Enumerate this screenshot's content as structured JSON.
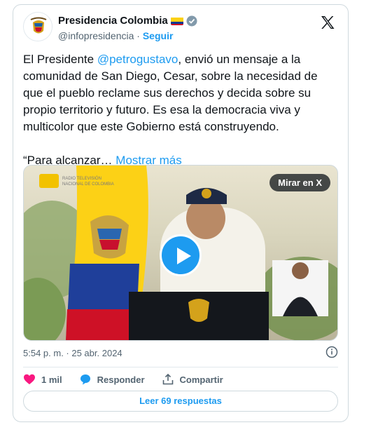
{
  "account": {
    "name": "Presidencia Colombia",
    "handle": "@infopresidencia",
    "separator": "·",
    "follow_label": "Seguir"
  },
  "tweet": {
    "text_part1": "El Presidente ",
    "mention": "@petrogustavo",
    "text_part2": ", envió un mensaje a la comunidad de San Diego, Cesar, sobre la necesidad de que el pueblo reclame sus derechos y decida sobre su propio territorio y futuro. Es esa la democracia viva y multicolor que este Gobierno está construyendo.\n\n“Para alcanzar… ",
    "show_more": "Mostrar más",
    "timestamp": "5:54 p. m. · 25 abr. 2024"
  },
  "media": {
    "watch_on_x_label": "Mirar en X",
    "logo_text": "RADIO TELEVISIÓN NACIONAL DE COLOMBIA"
  },
  "actions": {
    "likes": "1 mil",
    "reply_label": "Responder",
    "share_label": "Compartir"
  },
  "replies_button": "Leer 69 respuestas",
  "colors": {
    "accent": "#1d9bf0",
    "like": "#f91880",
    "text": "#0f1419",
    "secondary": "#536471"
  }
}
